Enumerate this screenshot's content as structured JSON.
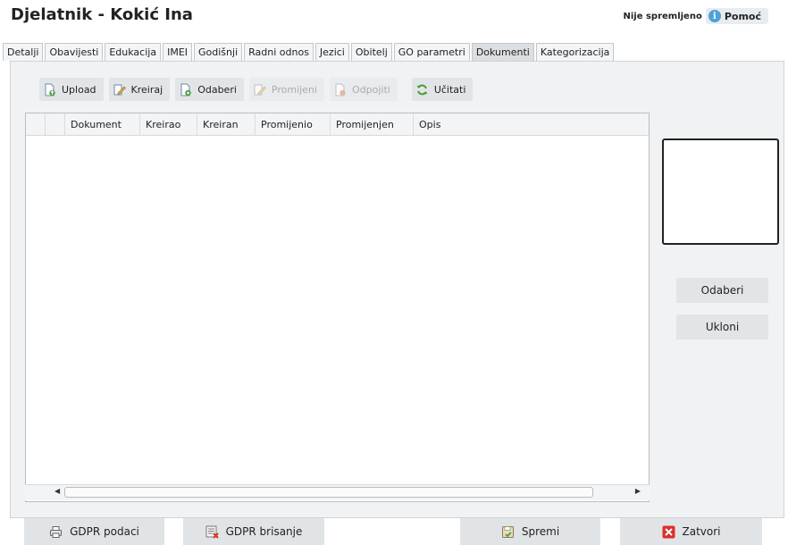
{
  "window": {
    "title": "Djelatnik - Kokić Ina",
    "status": "Nije spremljeno",
    "help_label": "Pomoć",
    "help_icon": "info-icon"
  },
  "tabs": [
    {
      "label": "Detalji",
      "active": false
    },
    {
      "label": "Obavijesti",
      "active": false
    },
    {
      "label": "Edukacija",
      "active": false
    },
    {
      "label": "IMEI",
      "active": false
    },
    {
      "label": "Godišnji",
      "active": false
    },
    {
      "label": "Radni odnos",
      "active": false
    },
    {
      "label": "Jezici",
      "active": false
    },
    {
      "label": "Obitelj",
      "active": false
    },
    {
      "label": "GO parametri",
      "active": false
    },
    {
      "label": "Dokumenti",
      "active": true
    },
    {
      "label": "Kategorizacija",
      "active": false
    }
  ],
  "toolbar": {
    "upload": {
      "label": "Upload",
      "icon": "upload-icon",
      "enabled": true
    },
    "kreiraj": {
      "label": "Kreiraj",
      "icon": "edit-icon",
      "enabled": true
    },
    "odaberi": {
      "label": "Odaberi",
      "icon": "select-document-icon",
      "enabled": true
    },
    "promijeni": {
      "label": "Promijeni",
      "icon": "edit-icon",
      "enabled": false
    },
    "odpojiti": {
      "label": "Odpojiti",
      "icon": "detach-icon",
      "enabled": false
    },
    "ucitati": {
      "label": "Učitati",
      "icon": "refresh-icon",
      "enabled": true
    }
  },
  "grid": {
    "columns": [
      "Dokument",
      "Kreirao",
      "Kreiran",
      "Promijenio",
      "Promijenjen",
      "Opis"
    ],
    "rows": []
  },
  "side": {
    "odaberi": "Odaberi",
    "ukloni": "Ukloni"
  },
  "footer": {
    "gdpr_podaci": {
      "label": "GDPR podaci",
      "icon": "printer-icon"
    },
    "gdpr_brisanje": {
      "label": "GDPR brisanje",
      "icon": "delete-list-icon"
    },
    "spremi": {
      "label": "Spremi",
      "icon": "save-icon"
    },
    "zatvori": {
      "label": "Zatvori",
      "icon": "close-icon"
    }
  },
  "colors": {
    "panel_bg": "#f0f2f4",
    "button_bg": "#e2e5e8",
    "accent_green": "#5aa34a",
    "close_red": "#d9312b"
  }
}
